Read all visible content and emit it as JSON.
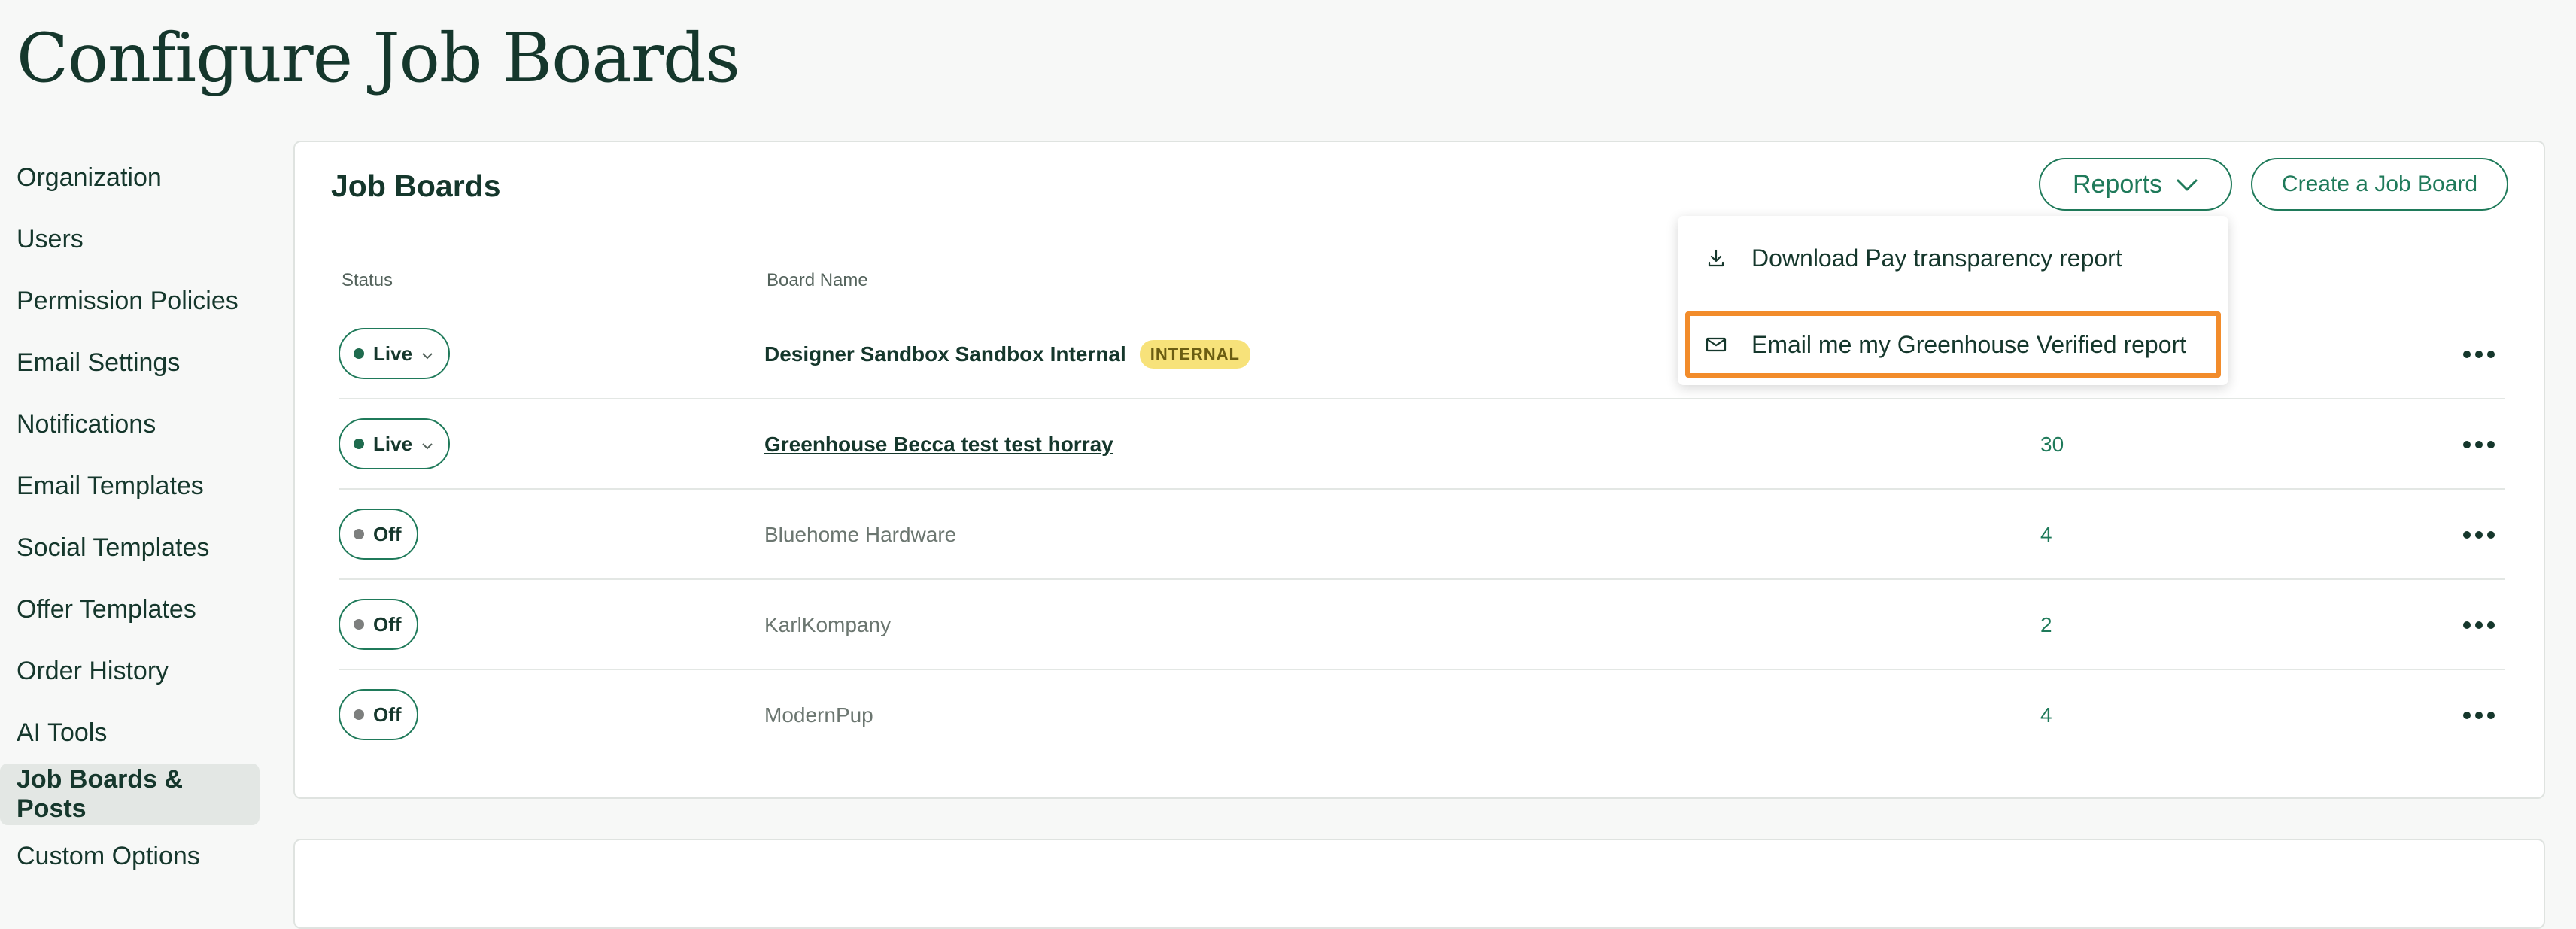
{
  "page": {
    "title": "Configure Job Boards"
  },
  "sidebar": {
    "items": [
      {
        "label": "Organization"
      },
      {
        "label": "Users"
      },
      {
        "label": "Permission Policies"
      },
      {
        "label": "Email Settings"
      },
      {
        "label": "Notifications"
      },
      {
        "label": "Email Templates"
      },
      {
        "label": "Social Templates"
      },
      {
        "label": "Offer Templates"
      },
      {
        "label": "Order History"
      },
      {
        "label": "AI Tools"
      },
      {
        "label": "Job Boards & Posts",
        "active": true
      },
      {
        "label": "Custom Options"
      }
    ]
  },
  "card": {
    "title": "Job Boards",
    "reports_label": "Reports",
    "create_label": "Create a Job Board",
    "columns": {
      "status": "Status",
      "board_name": "Board Name"
    },
    "rows": [
      {
        "status": "Live",
        "name": "Designer Sandbox Sandbox Internal",
        "badge": "INTERNAL",
        "count": ""
      },
      {
        "status": "Live",
        "name": "Greenhouse Becca test test horray",
        "count": "30"
      },
      {
        "status": "Off",
        "name": "Bluehome Hardware",
        "count": "4"
      },
      {
        "status": "Off",
        "name": "KarlKompany",
        "count": "2"
      },
      {
        "status": "Off",
        "name": "ModernPup",
        "count": "4"
      }
    ]
  },
  "reports_menu": {
    "items": [
      {
        "label": "Download Pay transparency report",
        "icon": "download-icon"
      },
      {
        "label": "Email me my Greenhouse Verified report",
        "icon": "mail-icon",
        "highlighted": true
      }
    ]
  },
  "colors": {
    "primary": "#1f7a5a",
    "text": "#15372c",
    "highlight": "#f28c2b",
    "badge": "#f7e27a"
  }
}
